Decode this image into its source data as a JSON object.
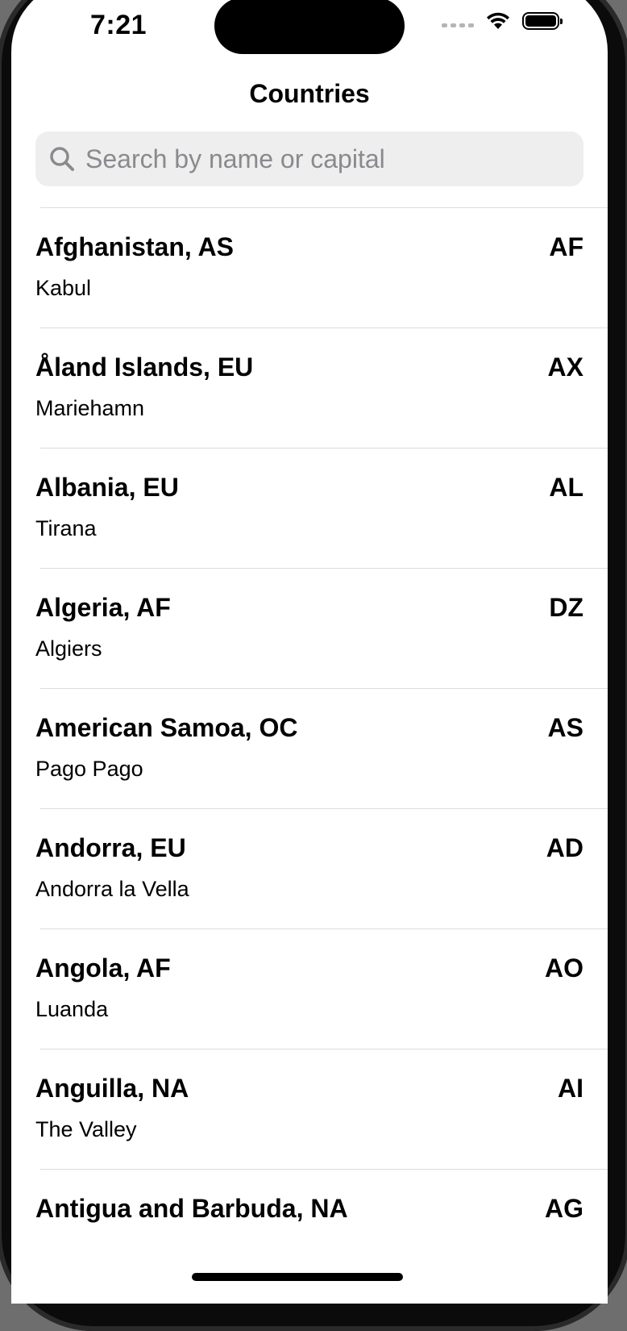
{
  "status_bar": {
    "time": "7:21",
    "icons": [
      "cellular-signal-icon",
      "wifi-icon",
      "battery-icon"
    ]
  },
  "nav": {
    "title": "Countries"
  },
  "search": {
    "placeholder": "Search by name or capital",
    "value": "",
    "icon": "search-icon"
  },
  "countries": [
    {
      "title": "Afghanistan, AS",
      "capital": "Kabul",
      "code": "AF"
    },
    {
      "title": "Åland Islands, EU",
      "capital": "Mariehamn",
      "code": "AX"
    },
    {
      "title": "Albania, EU",
      "capital": "Tirana",
      "code": "AL"
    },
    {
      "title": "Algeria, AF",
      "capital": "Algiers",
      "code": "DZ"
    },
    {
      "title": "American Samoa, OC",
      "capital": "Pago Pago",
      "code": "AS"
    },
    {
      "title": "Andorra, EU",
      "capital": "Andorra la Vella",
      "code": "AD"
    },
    {
      "title": "Angola, AF",
      "capital": "Luanda",
      "code": "AO"
    },
    {
      "title": "Anguilla, NA",
      "capital": "The Valley",
      "code": "AI"
    },
    {
      "title": "Antigua and Barbuda, NA",
      "capital": "",
      "code": "AG"
    }
  ]
}
